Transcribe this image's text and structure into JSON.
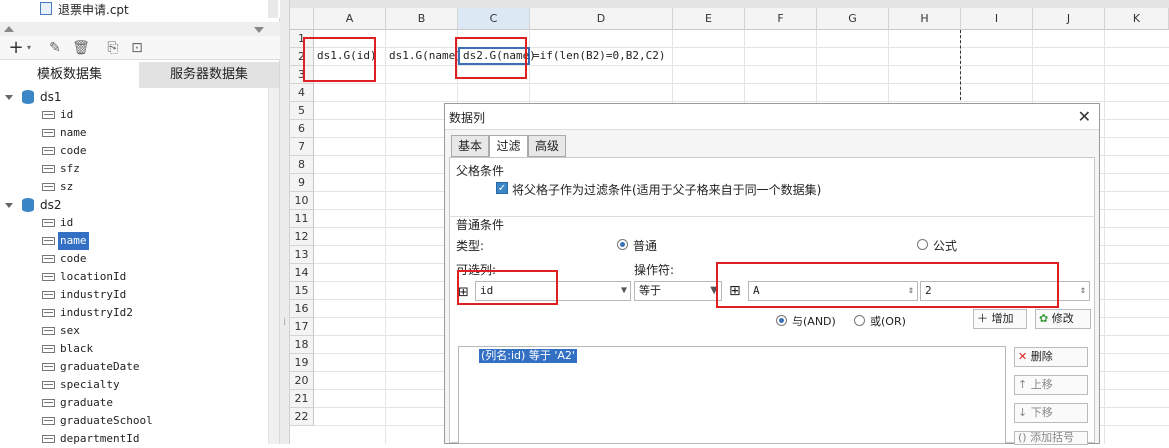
{
  "left_panel": {
    "file_name": "退票申请.cpt",
    "tabs": [
      "模板数据集",
      "服务器数据集"
    ],
    "datasets": [
      {
        "name": "ds1",
        "fields": [
          "id",
          "name",
          "code",
          "sfz",
          "sz"
        ]
      },
      {
        "name": "ds2",
        "fields": [
          "id",
          "name",
          "code",
          "locationId",
          "industryId",
          "industryId2",
          "sex",
          "black",
          "graduateDate",
          "specialty",
          "graduate",
          "graduateSchool",
          "departmentId"
        ]
      }
    ],
    "toolbar_icons": [
      "add-icon",
      "edit-icon",
      "delete-icon",
      "preview-icon",
      "settings-icon"
    ]
  },
  "sheet": {
    "columns": [
      "A",
      "B",
      "C",
      "D",
      "E",
      "F",
      "G",
      "H",
      "I",
      "J",
      "K"
    ],
    "rows": [
      "1",
      "2",
      "3",
      "4",
      "5",
      "6",
      "7",
      "8",
      "9",
      "10",
      "11",
      "12",
      "13",
      "14",
      "15",
      "16",
      "17",
      "18",
      "19",
      "20",
      "21",
      "22"
    ],
    "cells": {
      "A2": "ds1.G(id)",
      "B2": "ds1.G(name)",
      "C2": "ds2.G(name)",
      "D2": "=if(len(B2)=0,B2,C2)"
    }
  },
  "dialog": {
    "title": "数据列",
    "tabs": [
      "基本",
      "过滤",
      "高级"
    ],
    "parent_section": "父格条件",
    "parent_checkbox": "将父格子作为过滤条件(适用于父子格来自于同一个数据集)",
    "common_section": "普通条件",
    "type_label": "类型:",
    "type_normal": "普通",
    "type_formula": "公式",
    "column_label": "可选列:",
    "column_value": "id",
    "operator_label": "操作符:",
    "operator_value": "等于",
    "value1": "A",
    "value2": "2",
    "and_label": "与(AND)",
    "or_label": "或(OR)",
    "add_button": "增加",
    "modify_button": "修改",
    "delete_button": "删除",
    "up_button": "上移",
    "down_button": "下移",
    "bracket_button": "添加括号",
    "condition_item": "(列名:id) 等于 'A2'"
  }
}
